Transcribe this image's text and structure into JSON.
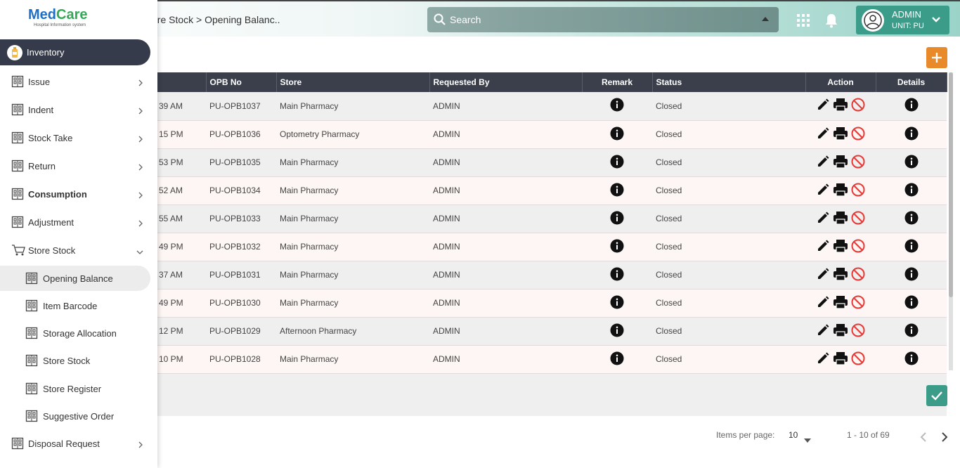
{
  "header": {
    "breadcrumb": "ore Stock > Opening Balanc..",
    "search_placeholder": "Search",
    "user_name": "ADMIN",
    "user_unit": "UNIT: PU"
  },
  "sidebar": {
    "logo_brand_1": "Med",
    "logo_brand_2": "Care",
    "logo_tagline": "Hospital Information system",
    "section": "Inventory",
    "items": [
      {
        "label": "Issue"
      },
      {
        "label": "Indent"
      },
      {
        "label": "Stock Take"
      },
      {
        "label": "Return"
      },
      {
        "label": "Consumption"
      },
      {
        "label": "Adjustment"
      },
      {
        "label": "Store Stock"
      }
    ],
    "sub_items": [
      {
        "label": "Opening Balance"
      },
      {
        "label": "Item Barcode"
      },
      {
        "label": "Storage Allocation"
      },
      {
        "label": "Store Stock"
      },
      {
        "label": "Store Register"
      },
      {
        "label": "Suggestive Order"
      }
    ],
    "last_item": "Disposal Request"
  },
  "table": {
    "columns": {
      "opb_no": "OPB No",
      "store": "Store",
      "requested_by": "Requested By",
      "remark": "Remark",
      "status": "Status",
      "action": "Action",
      "details": "Details"
    },
    "rows": [
      {
        "time": "39 AM",
        "opb": "PU-OPB1037",
        "store": "Main Pharmacy",
        "by": "ADMIN",
        "status": "Closed"
      },
      {
        "time": "15 PM",
        "opb": "PU-OPB1036",
        "store": "Optometry Pharmacy",
        "by": "ADMIN",
        "status": "Closed"
      },
      {
        "time": "53 PM",
        "opb": "PU-OPB1035",
        "store": "Main Pharmacy",
        "by": "ADMIN",
        "status": "Closed"
      },
      {
        "time": "52 AM",
        "opb": "PU-OPB1034",
        "store": "Main Pharmacy",
        "by": "ADMIN",
        "status": "Closed"
      },
      {
        "time": "55 AM",
        "opb": "PU-OPB1033",
        "store": "Main Pharmacy",
        "by": "ADMIN",
        "status": "Closed"
      },
      {
        "time": "49 PM",
        "opb": "PU-OPB1032",
        "store": "Main Pharmacy",
        "by": "ADMIN",
        "status": "Closed"
      },
      {
        "time": "37 AM",
        "opb": "PU-OPB1031",
        "store": "Main Pharmacy",
        "by": "ADMIN",
        "status": "Closed"
      },
      {
        "time": "49 PM",
        "opb": "PU-OPB1030",
        "store": "Main Pharmacy",
        "by": "ADMIN",
        "status": "Closed"
      },
      {
        "time": "12 PM",
        "opb": "PU-OPB1029",
        "store": "Afternoon Pharmacy",
        "by": "ADMIN",
        "status": "Closed"
      },
      {
        "time": "10 PM",
        "opb": "PU-OPB1028",
        "store": "Main Pharmacy",
        "by": "ADMIN",
        "status": "Closed"
      }
    ]
  },
  "paginator": {
    "items_per_page_label": "Items per page:",
    "page_size": "10",
    "range": "1 - 10 of 69"
  },
  "colors": {
    "accent": "#3c9c8a",
    "add_button": "#e88a2a",
    "table_header": "#3a3f4b",
    "sidebar_active": "#353b4a",
    "cancel_icon": "#e53935"
  }
}
